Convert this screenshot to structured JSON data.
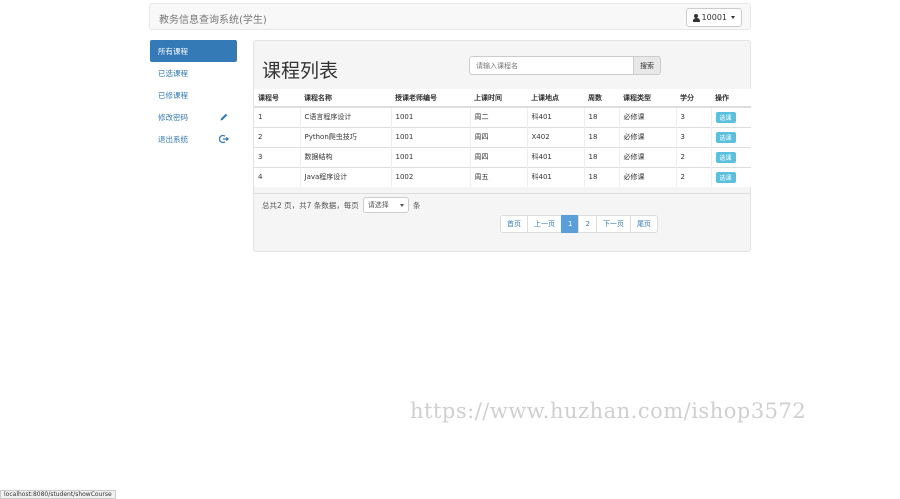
{
  "app": {
    "title": "教务信息查询系统(学生)",
    "user": "10001"
  },
  "sidebar": {
    "items": [
      {
        "label": "所有课程",
        "icon": ""
      },
      {
        "label": "已选课程",
        "icon": ""
      },
      {
        "label": "已修课程",
        "icon": ""
      },
      {
        "label": "修改密码",
        "icon": "pencil-icon"
      },
      {
        "label": "退出系统",
        "icon": "logout-icon"
      }
    ]
  },
  "main": {
    "title": "课程列表",
    "search": {
      "placeholder": "请输入课程名",
      "button": "搜索"
    },
    "table": {
      "headers": [
        "课程号",
        "课程名称",
        "授课老师编号",
        "上课时间",
        "上课地点",
        "周数",
        "课程类型",
        "学分",
        "操作"
      ],
      "rows": [
        {
          "id": "1",
          "name": "C语言程序设计",
          "teacher": "1001",
          "time": "周二",
          "place": "科401",
          "weeks": "18",
          "type": "必修课",
          "credit": "3",
          "action": "选课"
        },
        {
          "id": "2",
          "name": "Python爬虫技巧",
          "teacher": "1001",
          "time": "周四",
          "place": "X402",
          "weeks": "18",
          "type": "必修课",
          "credit": "3",
          "action": "选课"
        },
        {
          "id": "3",
          "name": "数据结构",
          "teacher": "1001",
          "time": "周四",
          "place": "科401",
          "weeks": "18",
          "type": "必修课",
          "credit": "2",
          "action": "选课"
        },
        {
          "id": "4",
          "name": "Java程序设计",
          "teacher": "1002",
          "time": "周五",
          "place": "科401",
          "weeks": "18",
          "type": "必修课",
          "credit": "2",
          "action": "选课"
        }
      ]
    },
    "summary": {
      "prefix": "总共2 页，共7 条数据，每页",
      "page_size": "请选择",
      "suffix": "条"
    },
    "pagination": {
      "first": "首页",
      "prev": "上一页",
      "pages": [
        "1",
        "2"
      ],
      "next": "下一页",
      "last": "尾页"
    }
  },
  "watermark": "https://www.huzhan.com/ishop3572",
  "status_url": "localhost:8080/student/showCourse",
  "colors": {
    "primary": "#337ab7",
    "info": "#5bc0de",
    "active_page": "#5a9fd8"
  }
}
